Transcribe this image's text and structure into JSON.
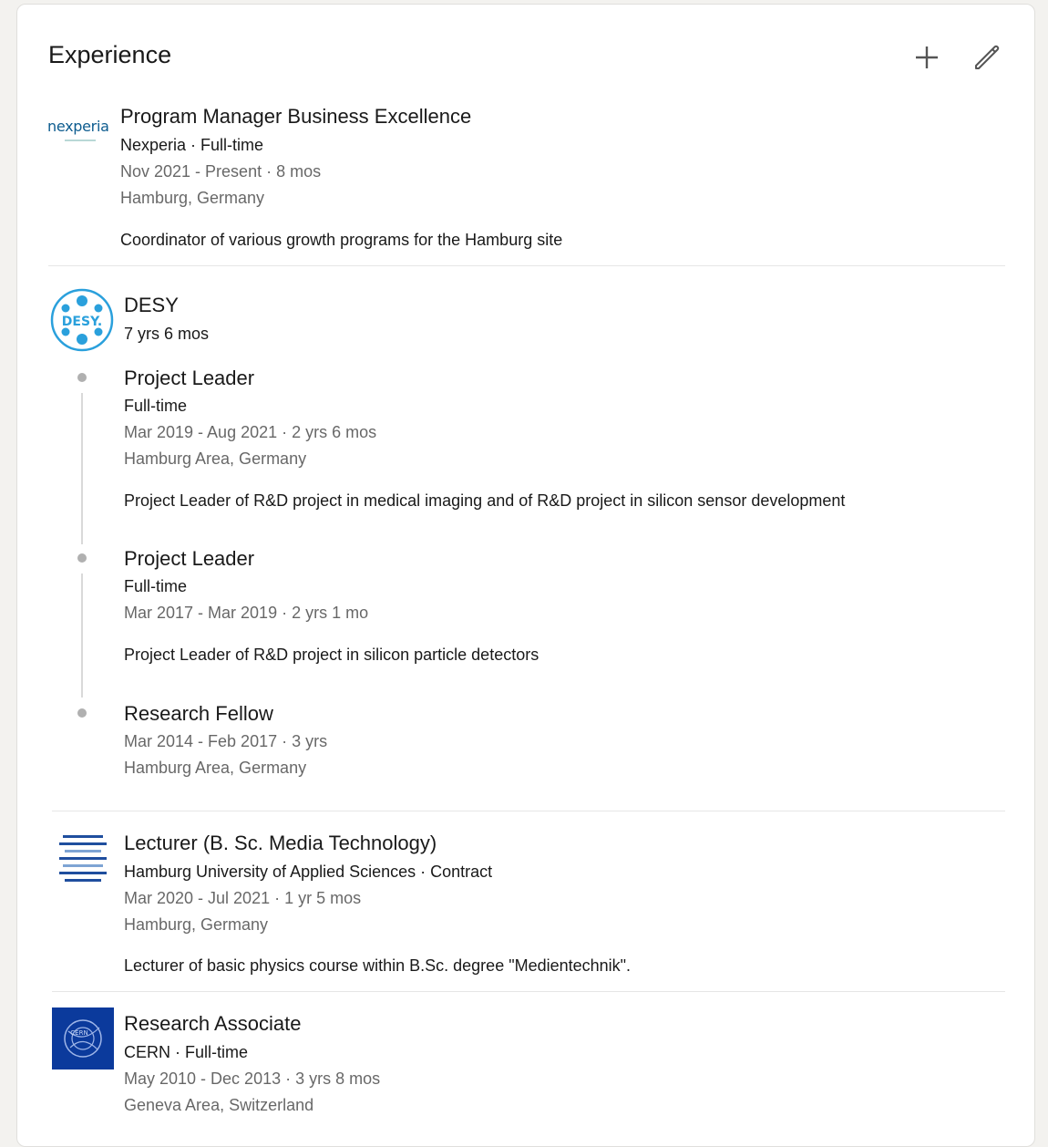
{
  "header": {
    "title": "Experience"
  },
  "nexperia": {
    "logo_text": "nexperia",
    "title": "Program Manager Business Excellence",
    "company_line": "Nexperia · Full-time",
    "dates": "Nov 2021 - Present · 8 mos",
    "location": "Hamburg, Germany",
    "description": "Coordinator of various growth programs for the Hamburg site"
  },
  "desy": {
    "logo_text": "DESY.",
    "company": "DESY",
    "duration": "7 yrs 6 mos",
    "roles": [
      {
        "title": "Project Leader",
        "type": "Full-time",
        "dates": "Mar 2019 - Aug 2021 · 2 yrs 6 mos",
        "location": "Hamburg Area, Germany",
        "description": "Project Leader of R&D project in medical imaging and of R&D project in silicon sensor development"
      },
      {
        "title": "Project Leader",
        "type": "Full-time",
        "dates": "Mar 2017 - Mar 2019 · 2 yrs 1 mo",
        "description": "Project Leader of R&D project in silicon particle detectors"
      },
      {
        "title": "Research Fellow",
        "dates": "Mar 2014 - Feb 2017 · 3 yrs",
        "location": "Hamburg Area, Germany"
      }
    ]
  },
  "haw": {
    "title": "Lecturer (B. Sc. Media Technology)",
    "company_line": "Hamburg University of Applied Sciences · Contract",
    "dates": "Mar 2020 - Jul 2021 · 1 yr 5 mos",
    "location": "Hamburg, Germany",
    "description": "Lecturer of basic physics course within B.Sc. degree \"Medientechnik\"."
  },
  "cern": {
    "logo_text": "CERN",
    "title": "Research Associate",
    "company_line": "CERN · Full-time",
    "dates": "May 2010 - Dec 2013 · 3 yrs 8 mos",
    "location": "Geneva Area, Switzerland"
  },
  "colors": {
    "desy_blue": "#2aa0dc",
    "nexperia_blue": "#0d5c8f",
    "nexperia_teal": "#27a8a0",
    "haw_blue": "#1f4e9e",
    "cern_blue": "#0b3a9c"
  }
}
